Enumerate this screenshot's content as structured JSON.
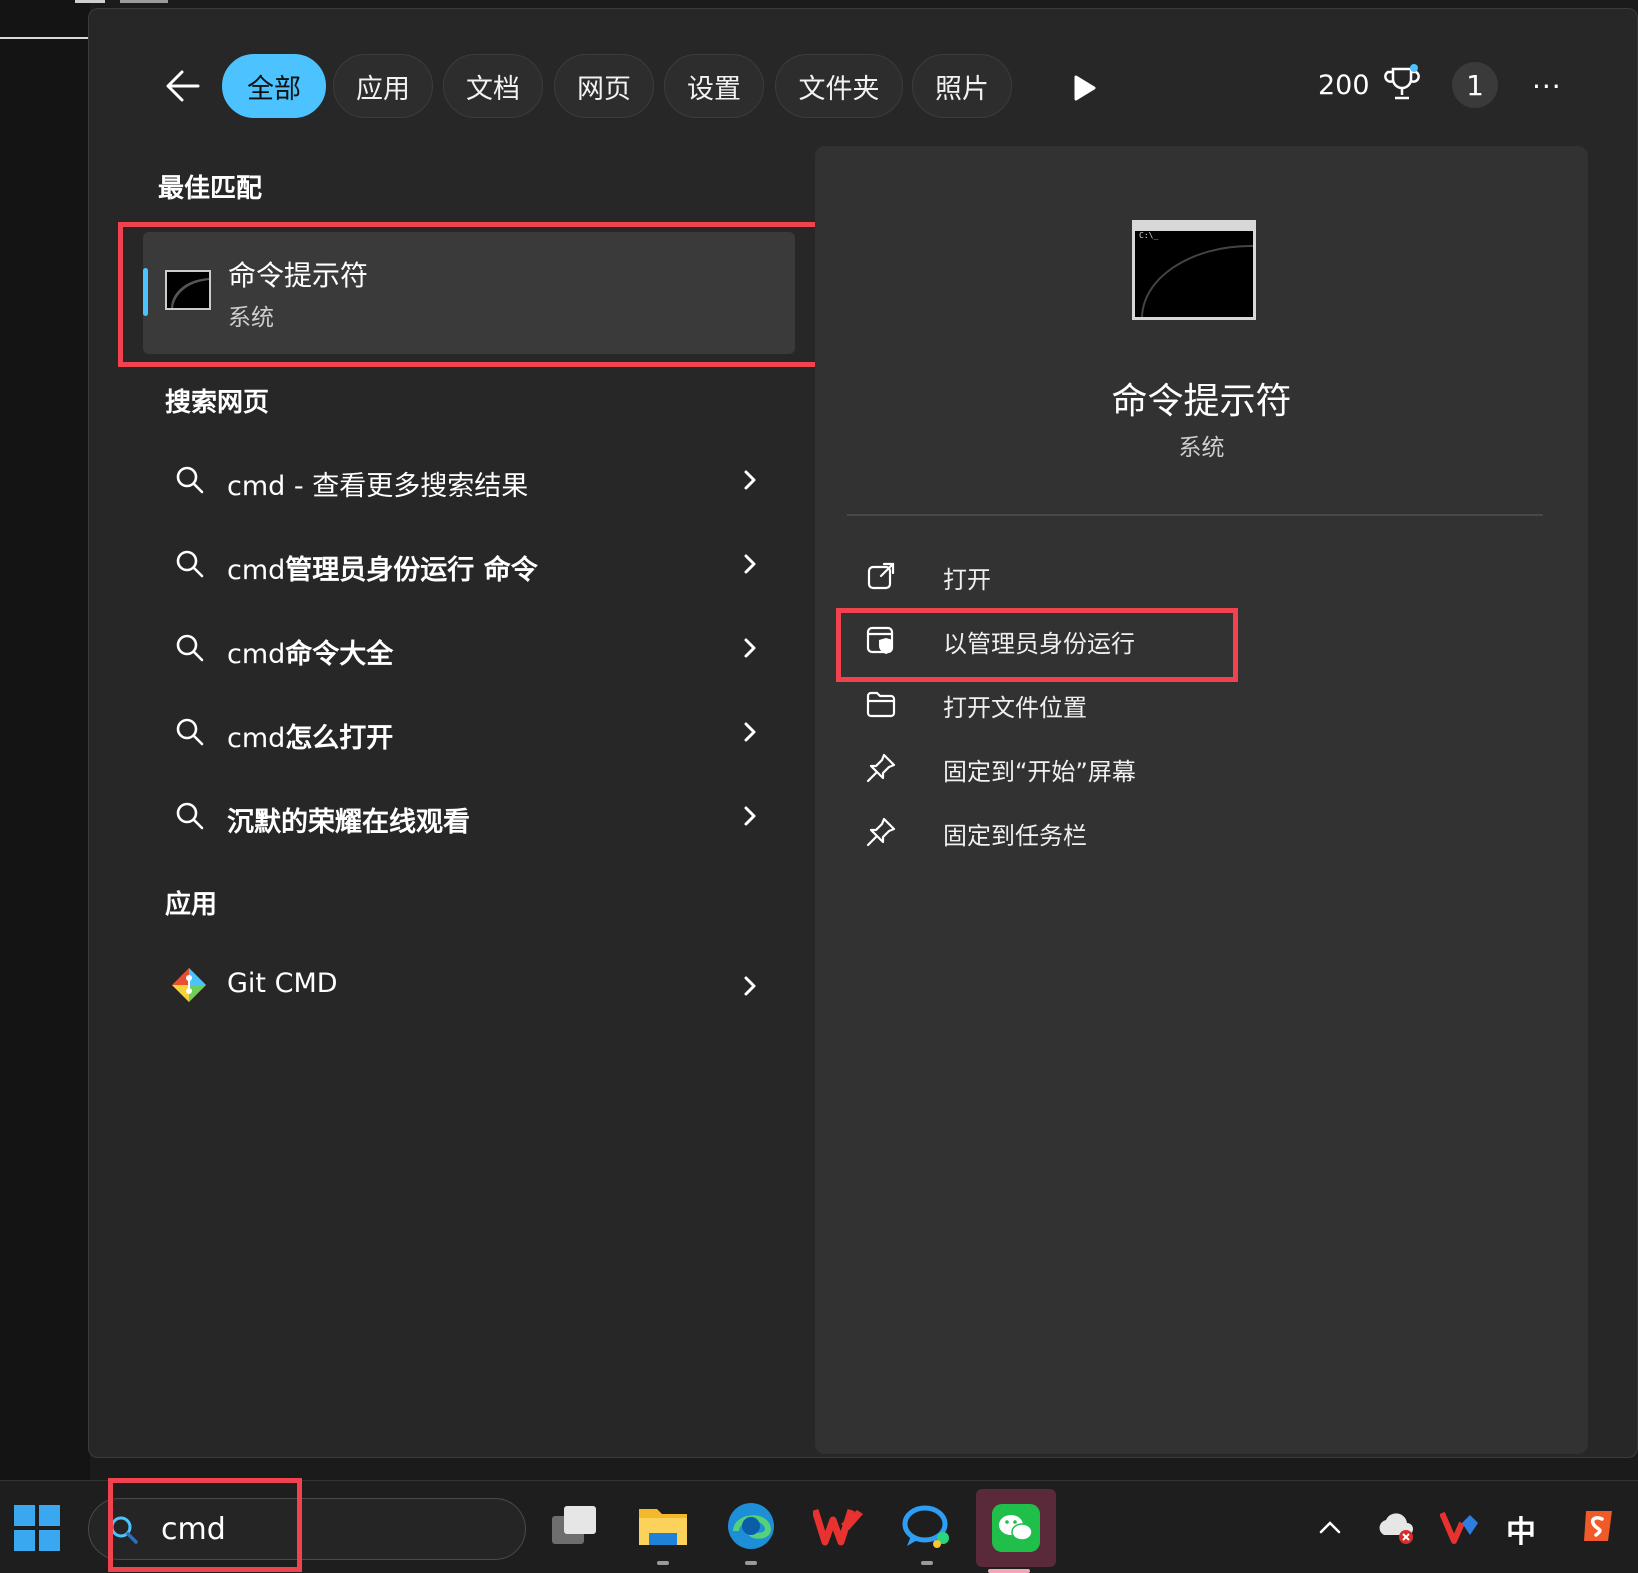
{
  "tabs": [
    "全部",
    "应用",
    "文档",
    "网页",
    "设置",
    "文件夹",
    "照片"
  ],
  "header": {
    "points": "200",
    "badge_count": "1",
    "more": "···"
  },
  "best_match": {
    "heading": "最佳匹配",
    "title": "命令提示符",
    "subtitle": "系统"
  },
  "web": {
    "heading": "搜索网页",
    "items": [
      {
        "prefix": "cmd",
        "rest": " - 查看更多搜索结果",
        "bold": false
      },
      {
        "prefix": "cmd",
        "rest": "管理员身份运行 命令",
        "bold": true
      },
      {
        "prefix": "cmd",
        "rest": "命令大全",
        "bold": true
      },
      {
        "prefix": "cmd",
        "rest": "怎么打开",
        "bold": true
      },
      {
        "prefix": "",
        "rest": "沉默的荣耀在线观看",
        "bold": true
      }
    ]
  },
  "apps": {
    "heading": "应用",
    "items": [
      {
        "label": "Git CMD"
      }
    ]
  },
  "detail": {
    "icon_prompt": "C:\\_",
    "title": "命令提示符",
    "subtitle": "系统",
    "actions": [
      {
        "label": "打开",
        "icon": "open-external-icon"
      },
      {
        "label": "以管理员身份运行",
        "icon": "admin-shield-icon"
      },
      {
        "label": "打开文件位置",
        "icon": "folder-icon"
      },
      {
        "label": "固定到“开始”屏幕",
        "icon": "pin-icon"
      },
      {
        "label": "固定到任务栏",
        "icon": "pin-icon"
      }
    ]
  },
  "taskbar": {
    "search_value": "cmd",
    "ime_label": "中"
  },
  "colors": {
    "accent": "#4cc2ff",
    "highlight": "#f0434f"
  }
}
